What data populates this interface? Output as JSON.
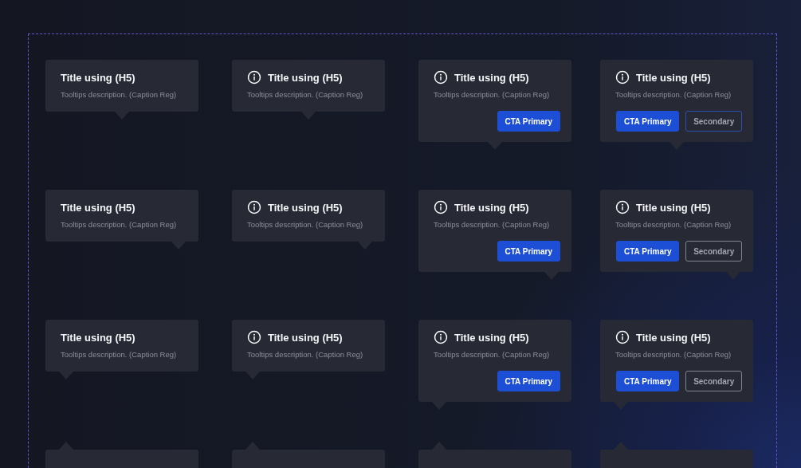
{
  "rows": [
    {
      "kind": "center",
      "cards": [
        {
          "kind": "full",
          "icon": false,
          "title": "Title using (H5)",
          "description": "Tooltips description. (Caption Reg)"
        },
        {
          "kind": "full",
          "icon": true,
          "title": "Title using (H5)",
          "description": "Tooltips description. (Caption Reg)"
        },
        {
          "kind": "full",
          "icon": true,
          "title": "Title using (H5)",
          "description": "Tooltips description. (Caption Reg)",
          "primary": "CTA Primary"
        },
        {
          "kind": "full",
          "icon": true,
          "title": "Title using (H5)",
          "description": "Tooltips description. (Caption Reg)",
          "primary": "CTA Primary",
          "secondary": {
            "label": "Secondary",
            "focused": true
          }
        }
      ]
    },
    {
      "kind": "right",
      "cards": [
        {
          "kind": "full",
          "icon": false,
          "title": "Title using (H5)",
          "description": "Tooltips description. (Caption Reg)"
        },
        {
          "kind": "full",
          "icon": true,
          "title": "Title using (H5)",
          "description": "Tooltips description. (Caption Reg)"
        },
        {
          "kind": "full",
          "icon": true,
          "title": "Title using (H5)",
          "description": "Tooltips description. (Caption Reg)",
          "primary": "CTA Primary"
        },
        {
          "kind": "full",
          "icon": true,
          "title": "Title using (H5)",
          "description": "Tooltips description. (Caption Reg)",
          "primary": "CTA Primary",
          "secondary": {
            "label": "Secondary",
            "focused": false
          }
        }
      ]
    },
    {
      "kind": "left",
      "cards": [
        {
          "kind": "full",
          "icon": false,
          "title": "Title using (H5)",
          "description": "Tooltips description. (Caption Reg)"
        },
        {
          "kind": "full",
          "icon": true,
          "title": "Title using (H5)",
          "description": "Tooltips description. (Caption Reg)"
        },
        {
          "kind": "full",
          "icon": true,
          "title": "Title using (H5)",
          "description": "Tooltips description. (Caption Reg)",
          "primary": "CTA Primary"
        },
        {
          "kind": "full",
          "icon": true,
          "title": "Title using (H5)",
          "description": "Tooltips description. (Caption Reg)",
          "primary": "CTA Primary",
          "secondary": {
            "label": "Secondary",
            "focused": false
          }
        }
      ]
    },
    {
      "kind": "top",
      "cards": [
        {
          "kind": "cut"
        },
        {
          "kind": "cut"
        },
        {
          "kind": "cut"
        },
        {
          "kind": "cut"
        }
      ]
    }
  ]
}
